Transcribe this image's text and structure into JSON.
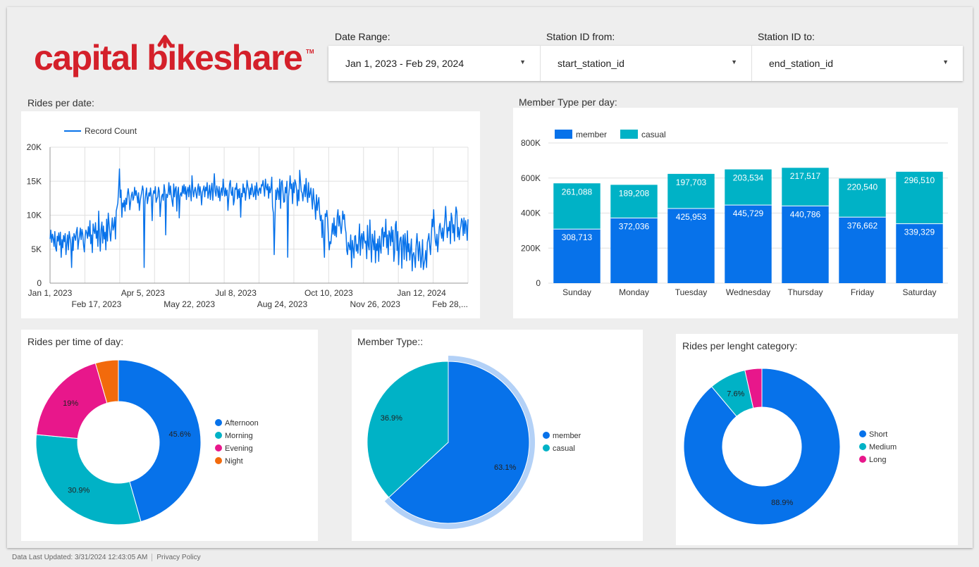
{
  "brand": {
    "name": "capital bikeshare",
    "tm": "TM",
    "color": "#d4202a"
  },
  "filters": [
    {
      "label": "Date Range:",
      "value": "Jan 1, 2023 - Feb 29, 2024"
    },
    {
      "label": "Station ID from:",
      "value": "start_station_id"
    },
    {
      "label": "Station ID to:",
      "value": "end_station_id"
    }
  ],
  "panels": {
    "rides_per_date": "Rides per date:",
    "member_type_per_day": "Member Type per day:",
    "rides_per_time": "Rides per time of day:",
    "member_type": "Member Type::",
    "rides_per_length": "Rides per lenght category:"
  },
  "footer": {
    "updated": "Data Last Updated: 3/31/2024 12:43:05 AM",
    "privacy": "Privacy Policy"
  },
  "colors": {
    "blue": "#0772ea",
    "teal": "#00b2c6",
    "pink": "#e8178b",
    "orange": "#f26a0c"
  },
  "chart_data": [
    {
      "type": "line",
      "legend": [
        "Record Count"
      ],
      "ylim": [
        0,
        20000
      ],
      "yticks": [
        "0",
        "5K",
        "10K",
        "15K",
        "20K"
      ],
      "xticks_top": [
        "Jan 1, 2023",
        "Apr 5, 2023",
        "Jul 8, 2023",
        "Oct 10, 2023",
        "Jan 12, 2024"
      ],
      "xticks_bottom": [
        "Feb 17, 2023",
        "May 22, 2023",
        "Aug 24, 2023",
        "Nov 26, 2023",
        "Feb 28,..."
      ],
      "series": [
        {
          "name": "Record Count",
          "values": [
            6500,
            7800,
            6000,
            7200,
            6600,
            5400,
            7600,
            5200,
            4700,
            6900,
            6200,
            7400,
            5600,
            7500,
            3800,
            6400,
            5200,
            7000,
            6100,
            7300,
            4200,
            5800,
            7100,
            4900,
            7600,
            6700,
            5900,
            2300,
            6800,
            4800,
            7300,
            6900,
            6300,
            7500,
            8200,
            5000,
            6200,
            7000,
            8100,
            6400,
            7900,
            7200,
            5600,
            4600,
            6800,
            7800,
            7400,
            6600,
            8300,
            6900,
            9200,
            5800,
            7100,
            4500,
            8700,
            7800,
            7300,
            8900,
            6600,
            7700,
            5400,
            10600,
            6900,
            4700,
            7800,
            9000,
            5900,
            8400,
            6500,
            7500,
            4900,
            9400,
            6200,
            10300,
            8800,
            7400,
            6200,
            8000,
            9600,
            7800,
            8300,
            9700,
            6500,
            10600,
            11200,
            11800,
            13800,
            16800,
            12600,
            13700,
            9700,
            11800,
            11200,
            12200,
            10600,
            12500,
            11600,
            13100,
            13900,
            12900,
            10800,
            11900,
            12900,
            13400,
            12200,
            12600,
            14100,
            12900,
            13600,
            12800,
            11800,
            13300,
            10700,
            12100,
            12800,
            13400,
            14300,
            13600,
            2300,
            12000,
            13100,
            14000,
            11700,
            12500,
            13300,
            12800,
            14000,
            12700,
            9200,
            12900,
            13600,
            13200,
            14200,
            11900,
            12400,
            12700,
            14100,
            13500,
            9800,
            11700,
            12800,
            13100,
            12200,
            14500,
            13500,
            7100,
            13100,
            12600,
            13200,
            14800,
            13000,
            14300,
            12900,
            12100,
            11300,
            14600,
            12700,
            13900,
            14200,
            10600,
            13400,
            14100,
            9600,
            12900,
            13300,
            12800,
            14300,
            13200,
            14500,
            13100,
            14200,
            12300,
            13600,
            14100,
            12700,
            14400,
            13400,
            12100,
            15800,
            13800,
            12700,
            13600,
            14100,
            13200,
            12500,
            13900,
            14600,
            12900,
            14200,
            13300,
            11500,
            13400,
            13800,
            14300,
            12700,
            14100,
            13600,
            14800,
            12500,
            13300,
            14400,
            12300,
            13800,
            14700,
            12200,
            14100,
            16100,
            13500,
            12800,
            14300,
            13700,
            12600,
            14200,
            12100,
            13400,
            14000,
            12900,
            15300,
            13800,
            12800,
            14000,
            12900,
            13700,
            10700,
            12500,
            14500,
            15100,
            13300,
            12900,
            14100,
            11500,
            12200,
            14000,
            13800,
            14700,
            12400,
            13800,
            12600,
            13900,
            9700,
            13200,
            12700,
            14600,
            13300,
            14000,
            12200,
            13500,
            15100,
            14200,
            13600,
            12400,
            14000,
            13000,
            14600,
            13800,
            12700,
            13100,
            14300,
            12300,
            14800,
            13600,
            12900,
            13800,
            14000,
            13200,
            14500,
            14300,
            15100,
            14000,
            12800,
            15300,
            14100,
            13700,
            14600,
            12500,
            14200,
            13300,
            14000,
            15600,
            11200,
            10300,
            4200,
            9200,
            13700,
            12300,
            14000,
            13500,
            12300,
            15300,
            11000,
            14800,
            15100,
            13400,
            11900,
            12000,
            14100,
            13300,
            15000,
            3800,
            12700,
            14000,
            15800,
            13900,
            14600,
            11700,
            14800,
            13300,
            15200,
            14700,
            13900,
            11400,
            13700,
            12100,
            16600,
            15100,
            13500,
            13300,
            12100,
            13500,
            14500,
            12700,
            15400,
            13100,
            11900,
            14800,
            12600,
            13100,
            14000,
            12400,
            10900,
            13900,
            12300,
            11400,
            9400,
            13000,
            10700,
            11800,
            12600,
            10300,
            9200,
            10000,
            6700,
            9300,
            6400,
            3800,
            10200,
            9800,
            10700,
            9300,
            6800,
            4900,
            6100,
            5800,
            7200,
            8800,
            7200,
            9600,
            7000,
            8400,
            6800,
            9800,
            10800,
            8400,
            9900,
            8500,
            7300,
            8600,
            10600,
            9400,
            10100,
            8200,
            7400,
            4800,
            4200,
            6000,
            5500,
            4900,
            7100,
            2300,
            6300,
            5200,
            3700,
            6900,
            7000,
            4700,
            5700,
            4400,
            6500,
            8700,
            4100,
            6800,
            7300,
            5100,
            7600,
            6400,
            5900,
            6200,
            3600,
            8500,
            5600,
            4900,
            9300,
            6000,
            3100,
            7200,
            6300,
            4900,
            7700,
            3000,
            5800,
            4800,
            6500,
            3200,
            6900,
            5300,
            4400,
            7900,
            8200,
            5400,
            7500,
            6800,
            9400,
            5200,
            7100,
            4200,
            7700,
            7300,
            5500,
            8300,
            6100,
            7800,
            3200,
            4500,
            8600,
            9100,
            4800,
            7600,
            2700,
            5600,
            6600,
            6800,
            2200,
            6200,
            7100,
            3500,
            7300,
            5800,
            3300,
            7700,
            4600,
            5800,
            3400,
            4900,
            6500,
            1800,
            4200,
            4500,
            3700,
            2300,
            5500,
            7300,
            5400,
            3300,
            6100,
            4800,
            2300,
            4000,
            6400,
            2000,
            2900,
            3500,
            4800,
            2300,
            6000,
            6500,
            7300,
            5400,
            4200,
            6800,
            9400,
            8300,
            10800,
            7900,
            6200,
            5500,
            7200,
            4600,
            6200,
            8300,
            8800,
            7500,
            6600,
            8100,
            6200,
            7800,
            9300,
            11300,
            9000,
            6700,
            8200,
            7700,
            9100,
            5800,
            10300,
            9500,
            7400,
            8600,
            6200,
            9300,
            11200,
            10500,
            6800,
            8200,
            6400,
            7900,
            8400,
            9500,
            9100,
            7000,
            9600,
            7300,
            9200,
            8500,
            6300,
            9400
          ]
        }
      ]
    },
    {
      "type": "bar",
      "stacked": true,
      "categories": [
        "Sunday",
        "Monday",
        "Tuesday",
        "Wednesday",
        "Thursday",
        "Friday",
        "Saturday"
      ],
      "series": [
        {
          "name": "member",
          "values": [
            308713,
            372036,
            425953,
            445729,
            440786,
            376662,
            339329
          ],
          "labels": [
            "308,713",
            "372,036",
            "425,953",
            "445,729",
            "440,786",
            "376,662",
            "339,329"
          ]
        },
        {
          "name": "casual",
          "values": [
            261088,
            189208,
            197703,
            203534,
            217517,
            220540,
            296510
          ],
          "labels": [
            "261,088",
            "189,208",
            "197,703",
            "203,534",
            "217,517",
            "220,540",
            "296,510"
          ]
        }
      ],
      "ylim": [
        0,
        800000
      ],
      "yticks": [
        "0",
        "200K",
        "400K",
        "600K",
        "800K"
      ],
      "legend": "top-left"
    },
    {
      "type": "pie",
      "donut": true,
      "labels": [
        "Afternoon",
        "Morning",
        "Evening",
        "Night"
      ],
      "values": [
        45.6,
        30.9,
        19.0,
        4.5
      ],
      "value_labels": [
        "45.6%",
        "30.9%",
        "19%",
        ""
      ]
    },
    {
      "type": "pie",
      "donut": false,
      "labels": [
        "member",
        "casual"
      ],
      "values": [
        63.1,
        36.9
      ],
      "value_labels": [
        "63.1%",
        "36.9%"
      ]
    },
    {
      "type": "pie",
      "donut": true,
      "labels": [
        "Short",
        "Medium",
        "Long"
      ],
      "values": [
        88.9,
        7.6,
        3.5
      ],
      "value_labels": [
        "88.9%",
        "7.6%",
        ""
      ]
    }
  ]
}
